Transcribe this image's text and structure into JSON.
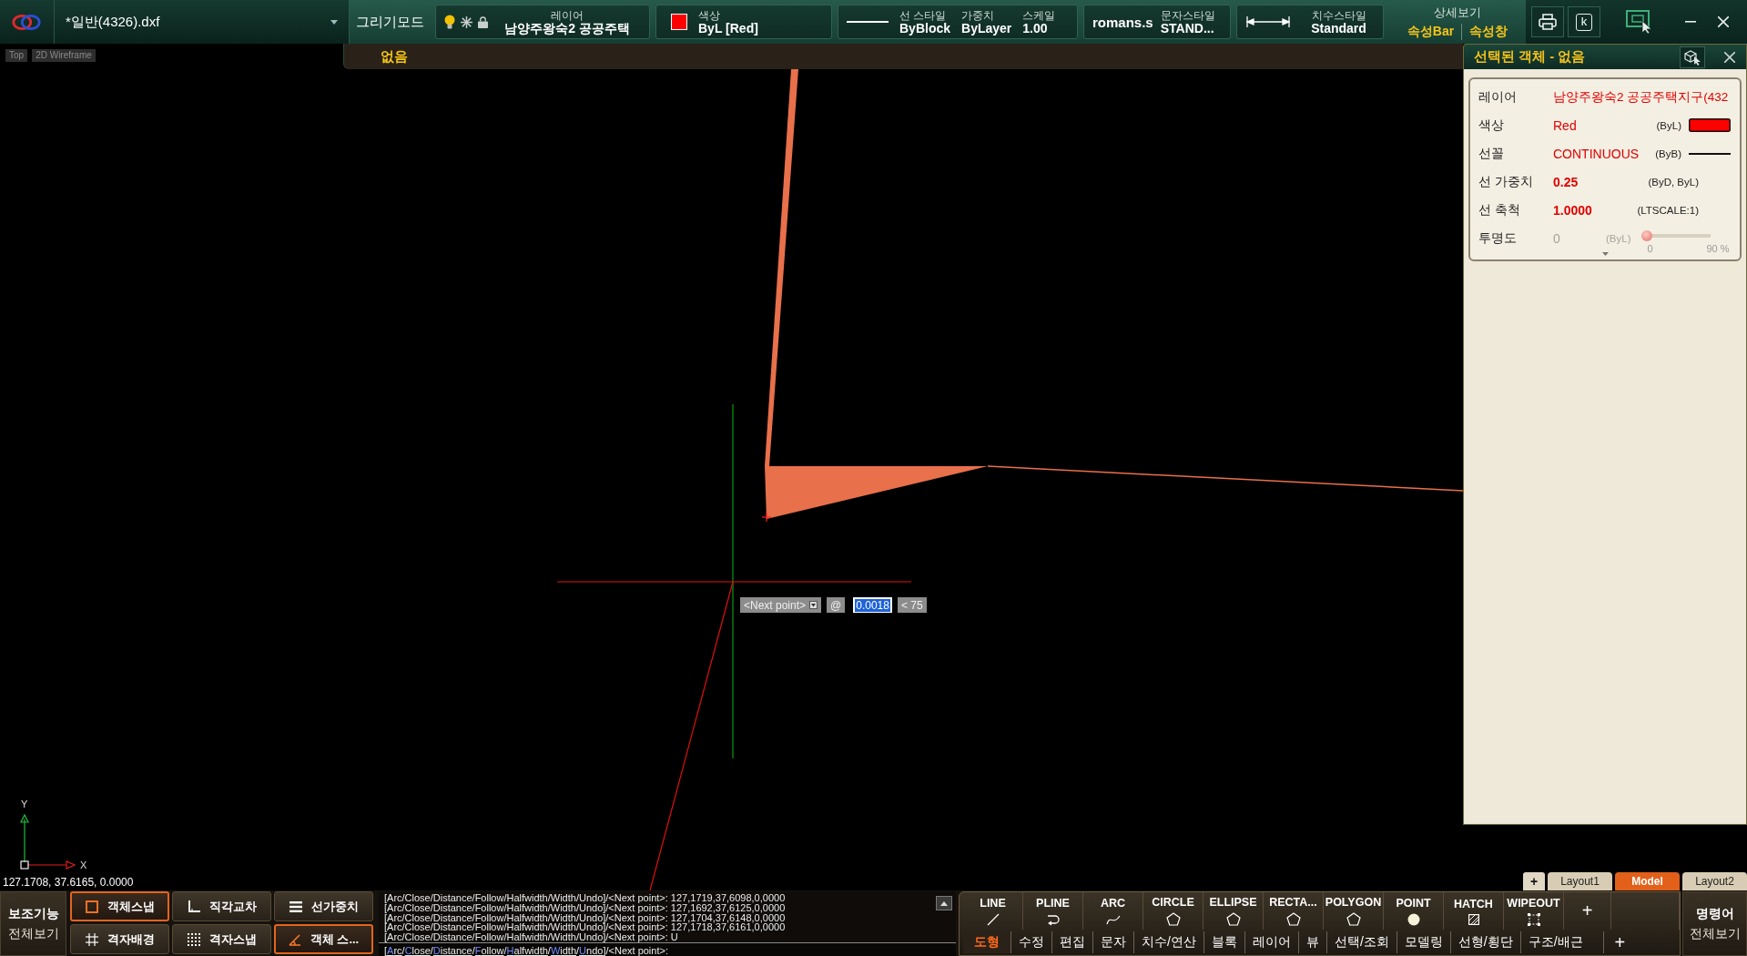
{
  "file_tab": {
    "title": "*일반(4326).dxf"
  },
  "toolbar": {
    "mode_button": "그리기모드",
    "layer": {
      "label": "레이어",
      "value": "남양주왕숙2 공공주택"
    },
    "color": {
      "label": "색상",
      "value": "ByL [Red]"
    },
    "line_style": [
      {
        "label": "선 스타일",
        "value": "ByBlock"
      },
      {
        "label": "가중치",
        "value": "ByLayer"
      },
      {
        "label": "스케일",
        "value": "1.00"
      }
    ],
    "text_style": {
      "font": "romans.s",
      "label": "문자스타일",
      "value": "STAND..."
    },
    "dim_style": {
      "label": "치수스타일",
      "value": "Standard"
    },
    "detail_view": {
      "label": "상세보기",
      "links": [
        "속성Bar",
        "속성창"
      ]
    },
    "key_button": "k"
  },
  "selection_bar": {
    "text": "없음"
  },
  "view_labels": [
    "Top",
    "2D Wireframe"
  ],
  "dynamic_input": {
    "prompt": "<Next point>",
    "at": "@",
    "value": "0.0018",
    "angle": "< 75"
  },
  "ucs": {
    "x_label": "X",
    "y_label": "Y"
  },
  "coordinates": "127.1708, 37.6165, 0.0000",
  "properties_panel": {
    "title": "선택된 객체 - 없음",
    "rows": [
      {
        "kind": "layer",
        "label": "레이어",
        "value": "남양주왕숙2 공공주택지구(432",
        "disabled": false
      },
      {
        "kind": "color",
        "label": "색상",
        "value": "Red",
        "note": "(ByL)",
        "disabled": false
      },
      {
        "kind": "linetype",
        "label": "선꼴",
        "value": "CONTINUOUS",
        "note": "(ByB)",
        "disabled": false
      },
      {
        "kind": "number",
        "label": "선 가중치",
        "value": "0.25",
        "note": "(ByD, ByL)",
        "disabled": false
      },
      {
        "kind": "number",
        "label": "선 축척",
        "value": "1.0000",
        "note": "(LTSCALE:1)",
        "disabled": false
      },
      {
        "kind": "slider",
        "label": "투명도",
        "value": "0",
        "note": "(ByL)",
        "level": 0,
        "min_label": "0",
        "max_label": "90 %",
        "disabled": true
      }
    ]
  },
  "layout_tabs": {
    "add": "+",
    "tabs": [
      {
        "label": "Layout1",
        "selected": false
      },
      {
        "label": "Model",
        "selected": true
      },
      {
        "label": "Layout2",
        "selected": false
      }
    ]
  },
  "assist": {
    "title": "보조기능",
    "subtitle": "전체보기"
  },
  "toggles": [
    {
      "kind": "snap",
      "label": "객체스냅",
      "on": true
    },
    {
      "kind": "ortho",
      "label": "직각교차",
      "on": false
    },
    {
      "kind": "lineweight",
      "label": "선가중치",
      "on": false
    },
    {
      "kind": "grid",
      "label": "격자배경",
      "on": false
    },
    {
      "kind": "gridsnap",
      "label": "격자스냅",
      "on": false
    },
    {
      "kind": "track",
      "label": "객체 스...",
      "on": true
    }
  ],
  "command_line": {
    "history": [
      "[Arc/Close/Distance/Follow/Halfwidth/Width/Undo]/<Next point>: 127,1719,37,6098,0,0000",
      "[Arc/Close/Distance/Follow/Halfwidth/Width/Undo]/<Next point>: 127,1692,37,6125,0,0000",
      "[Arc/Close/Distance/Follow/Halfwidth/Width/Undo]/<Next point>: 127,1704,37,6148,0,0000",
      "[Arc/Close/Distance/Follow/Halfwidth/Width/Undo]/<Next point>: 127,1718,37,6161,0,0000",
      "[Arc/Close/Distance/Follow/Halfwidth/Width/Undo]/<Next point>: U"
    ],
    "prompt": {
      "open": "[",
      "options": [
        {
          "key": "A",
          "rest": "rc"
        },
        {
          "key": "C",
          "rest": "lose"
        },
        {
          "key": "D",
          "rest": "istance"
        },
        {
          "key": "F",
          "rest": "ollow"
        },
        {
          "key": "H",
          "rest": "alfwidth"
        },
        {
          "key": "W",
          "rest": "idth"
        },
        {
          "key": "U",
          "rest": "ndo"
        }
      ],
      "separator": "/",
      "close": "]/<Next point>:"
    }
  },
  "ribbon": {
    "commands": [
      {
        "kind": "line",
        "label": "LINE"
      },
      {
        "kind": "pline",
        "label": "PLINE"
      },
      {
        "kind": "arc",
        "label": "ARC"
      },
      {
        "kind": "shape",
        "label": "CIRCLE"
      },
      {
        "kind": "shape",
        "label": "ELLIPSE"
      },
      {
        "kind": "shape",
        "label": "RECTA..."
      },
      {
        "kind": "shape",
        "label": "POLYGON"
      },
      {
        "kind": "point",
        "label": "POINT"
      },
      {
        "kind": "hatch",
        "label": "HATCH"
      },
      {
        "kind": "wipeout",
        "label": "WIPEOUT"
      },
      {
        "kind": "add",
        "label": "+"
      }
    ],
    "tabs": [
      {
        "label": "도형",
        "selected": true
      },
      {
        "label": "수정",
        "selected": false
      },
      {
        "label": "편집",
        "selected": false
      },
      {
        "label": "문자",
        "selected": false
      },
      {
        "label": "치수/연산",
        "selected": false
      },
      {
        "label": "블록",
        "selected": false
      },
      {
        "label": "레이어",
        "selected": false
      },
      {
        "label": "뷰",
        "selected": false
      },
      {
        "label": "선택/조회",
        "selected": false
      },
      {
        "label": "모델링",
        "selected": false
      },
      {
        "label": "선형/횡단",
        "selected": false
      },
      {
        "label": "구조/배근",
        "selected": false
      }
    ],
    "add_tab": "+"
  },
  "command_panel": {
    "title": "명령어",
    "subtitle": "전체보기"
  }
}
